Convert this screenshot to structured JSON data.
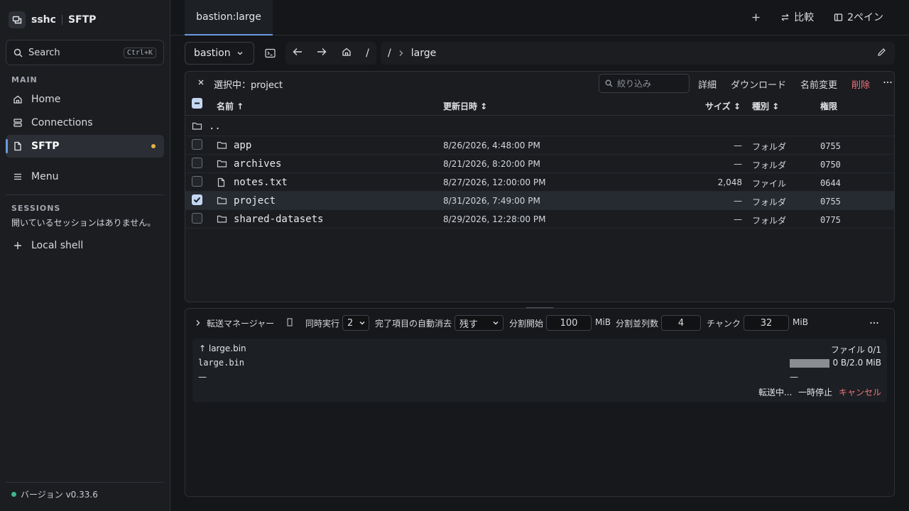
{
  "app": {
    "name": "sshc",
    "section": "SFTP"
  },
  "sidebar": {
    "search_label": "Search",
    "search_shortcut": "Ctrl+K",
    "main_label": "MAIN",
    "items": [
      {
        "label": "Home",
        "icon": "home-icon"
      },
      {
        "label": "Connections",
        "icon": "server-icon"
      },
      {
        "label": "SFTP",
        "icon": "file-icon",
        "active": true
      },
      {
        "label": "Menu",
        "icon": "menu-icon"
      }
    ],
    "sessions_label": "SESSIONS",
    "sessions_empty": "開いているセッションはありません。",
    "local_shell": "Local shell",
    "version": "バージョン v0.33.6"
  },
  "tabs": [
    {
      "label": "bastion:large"
    }
  ],
  "tabbar": {
    "compare": "比較",
    "two_pane": "2ペイン"
  },
  "toolbar": {
    "host": "bastion",
    "home_path": "/",
    "path_root": "/",
    "path_current": "large"
  },
  "selection": {
    "label": "選択中：project",
    "filter_placeholder": "絞り込み",
    "actions": {
      "details": "詳細",
      "download": "ダウンロード",
      "rename": "名前変更",
      "delete": "削除"
    }
  },
  "table": {
    "headers": {
      "name": "名前 ↑",
      "modified": "更新日時 ↕",
      "size": "サイズ ↕",
      "kind": "種別 ↕",
      "perm": "権限"
    },
    "parent": "..",
    "rows": [
      {
        "name": "app",
        "type": "folder",
        "modified": "8/26/2026, 4:48:00 PM",
        "size": "—",
        "kind": "フォルダ",
        "perm": "0755",
        "checked": false
      },
      {
        "name": "archives",
        "type": "folder",
        "modified": "8/21/2026, 8:20:00 PM",
        "size": "—",
        "kind": "フォルダ",
        "perm": "0750",
        "checked": false
      },
      {
        "name": "notes.txt",
        "type": "file",
        "modified": "8/27/2026, 12:00:00 PM",
        "size": "2,048",
        "kind": "ファイル",
        "perm": "0644",
        "checked": false
      },
      {
        "name": "project",
        "type": "folder",
        "modified": "8/31/2026, 7:49:00 PM",
        "size": "—",
        "kind": "フォルダ",
        "perm": "0755",
        "checked": true
      },
      {
        "name": "shared-datasets",
        "type": "folder",
        "modified": "8/29/2026, 12:28:00 PM",
        "size": "—",
        "kind": "フォルダ",
        "perm": "0775",
        "checked": false
      }
    ]
  },
  "transfer": {
    "title": "転送マネージャー",
    "concurrency_label": "同時実行",
    "concurrency_value": "2",
    "autoclear_label": "完了項目の自動消去",
    "autoclear_value": "残す",
    "split_start_label": "分割開始",
    "split_start_value": "100",
    "unit1": "MiB",
    "split_parallel_label": "分割並列数",
    "split_parallel_value": "4",
    "chunk_label": "チャンク",
    "chunk_value": "32",
    "unit2": "MiB",
    "job": {
      "title": "↑ large.bin",
      "file_count": "ファイル  0/1",
      "filename": "large.bin",
      "progress_text": "0 B/2.0 MiB",
      "progress_fraction": 0,
      "left_dash": "—",
      "right_dash": "—",
      "status": "転送中...",
      "pause": "一時停止",
      "cancel": "キャンセル"
    }
  },
  "colors": {
    "accent": "#6a9ae0",
    "danger": "#f0767a",
    "session_dot": "#e3b341",
    "version_dot": "#3fb68b"
  }
}
